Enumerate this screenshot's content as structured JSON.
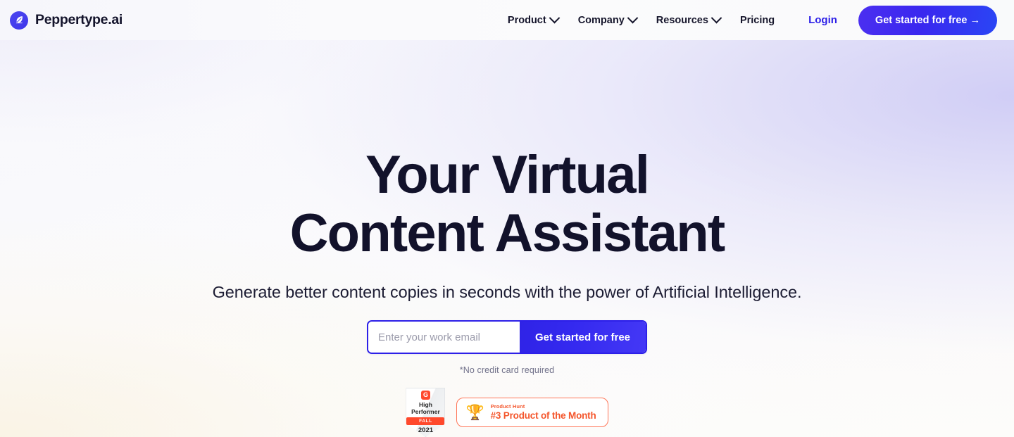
{
  "brand": {
    "name": "Peppertype.ai",
    "logo_icon": "feather-quill-icon",
    "logo_color": "#4038ee"
  },
  "header": {
    "nav_items": [
      {
        "label": "Product",
        "has_dropdown": true
      },
      {
        "label": "Company",
        "has_dropdown": true
      },
      {
        "label": "Resources",
        "has_dropdown": true
      },
      {
        "label": "Pricing",
        "has_dropdown": false
      }
    ],
    "login_label": "Login",
    "login_color": "#2d20e8",
    "cta_label": "Get started for free →",
    "cta_color": "#3a27ef"
  },
  "hero": {
    "headline_line1": "Your Virtual",
    "headline_line2": "Content Assistant",
    "subheadline": "Generate better content copies in seconds with the power of Artificial Intelligence.",
    "headline_color": "#12122b"
  },
  "signup": {
    "email_placeholder": "Enter your work email",
    "email_value": "",
    "submit_label": "Get started for free",
    "fineprint": "*No credit card required",
    "accent_color": "#2d20e8"
  },
  "badges": {
    "g2": {
      "logo_glyph": "G",
      "title": "High\nPerformer",
      "title_line1": "High",
      "title_line2": "Performer",
      "season": "FALL",
      "year": "2021",
      "accent_color": "#ff492c"
    },
    "product_hunt": {
      "icon": "trophy-icon",
      "kicker": "Product Hunt",
      "title": "#3 Product of the Month",
      "accent_color": "#f4552b"
    }
  }
}
